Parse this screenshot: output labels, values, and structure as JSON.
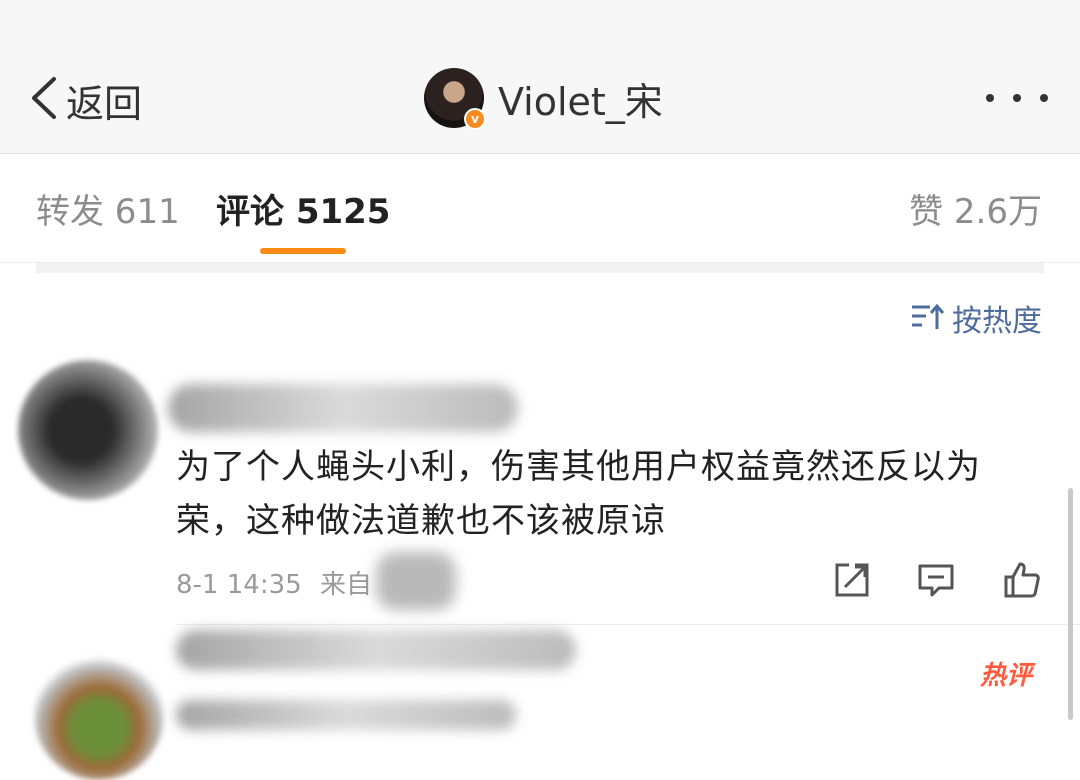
{
  "nav": {
    "back_label": "返回",
    "username": "Violet_宋",
    "verified_badge": "v",
    "more_icon": "more-dots-icon"
  },
  "tabs": {
    "repost": "转发 611",
    "comment": "评论 5125",
    "like": "赞 2.6万",
    "active": "comment",
    "accent_color": "#f98a14"
  },
  "sort": {
    "label": "按热度",
    "icon": "sort-icon"
  },
  "comments": [
    {
      "author": "",
      "text": "为了个人蝇头小利，伤害其他用户权益竟然还反以为荣，这种做法道歉也不该被原谅",
      "time": "8-1 14:35",
      "source": "来自",
      "actions": [
        "share-icon",
        "reply-icon",
        "like-icon"
      ]
    },
    {
      "author": "",
      "badge": "热评"
    }
  ]
}
